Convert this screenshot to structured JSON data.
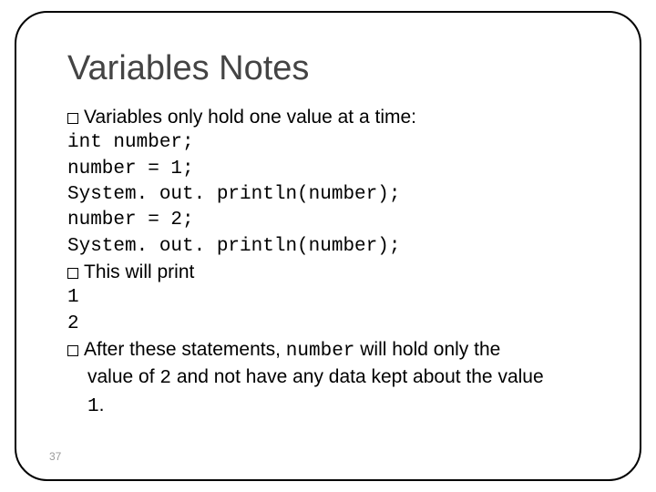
{
  "title": "Variables Notes",
  "bullet1": "Variables only hold one value at a time:",
  "code1": "int number;",
  "code2": "number = 1;",
  "code3": "System. out. println(number);",
  "code4": "number = 2;",
  "code5": "System. out. println(number);",
  "bullet2": "This will print",
  "out1": "1",
  "out2": "2",
  "bullet3_a": "After these statements, ",
  "bullet3_code1": "number",
  "bullet3_b": " will hold only the value of ",
  "bullet3_code2": "2",
  "bullet3_c": " and not have any data kept about the value ",
  "bullet3_code3": "1",
  "bullet3_d": ".",
  "page_number": "37"
}
